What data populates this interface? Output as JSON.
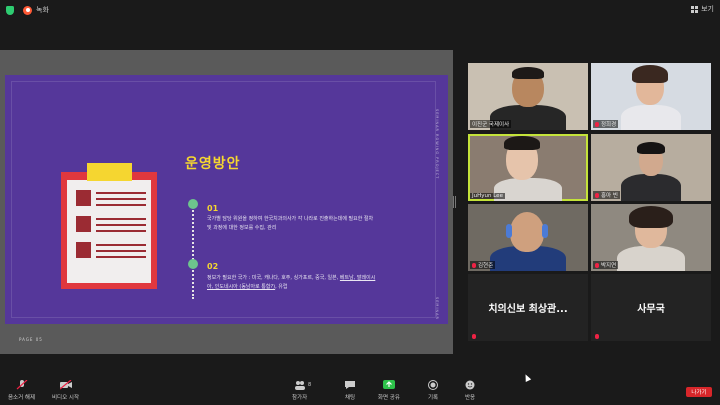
{
  "topbar": {
    "recording_label": "녹화",
    "view_label": "보기"
  },
  "slide": {
    "title": "운영방안",
    "item1_num": "01",
    "item1_text_line1": "국가별 담당 위원을 정하여 한국치과의사가 각 나라로 진출하는데에 필요한 절차",
    "item1_text_line2": "및 과정에 대한 정보를 수집, 관리",
    "item2_num": "02",
    "item2_text_line1_a": "정보가 필요한 국가 : 미국, 캐나다, 호주, 싱가포르, 중국, 일본, ",
    "item2_text_line1_ul": "베트남, 말레이시",
    "item2_text_line2_ul": "아, 인도네시아 (동남아로 통합?)",
    "item2_text_line2_b": ", 유럽",
    "vertical_top": "SEMINAR ROWING PROJECT",
    "vertical_bottom": "SEMINAR",
    "page_label": "PAGE 05"
  },
  "participants": [
    {
      "name": "이진군 국제이사",
      "muted": false
    },
    {
      "name": "정희경",
      "muted": true
    },
    {
      "name": "JuHyun Lee",
      "muted": false
    },
    {
      "name": "홍아 빈",
      "muted": true
    },
    {
      "name": "김현준",
      "muted": true
    },
    {
      "name": "박지연",
      "muted": true
    },
    {
      "name": "치의신보 최상관...",
      "muted": true
    },
    {
      "name": "사무국",
      "muted": true
    }
  ],
  "toolbar": {
    "mute": "음소거 해제",
    "video": "비디오 시작",
    "participants": "참가자",
    "participants_count": "8",
    "chat": "채팅",
    "share": "화면 공유",
    "record": "기록",
    "reactions": "반응",
    "leave": "나가기"
  }
}
